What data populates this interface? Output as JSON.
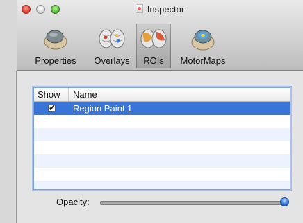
{
  "window": {
    "title": "Inspector"
  },
  "toolbar": {
    "items": [
      {
        "label": "Properties",
        "icon": "head-model-icon"
      },
      {
        "label": "Overlays",
        "icon": "brain-overlay-icon"
      },
      {
        "label": "ROIs",
        "icon": "brain-roi-icon",
        "selected": true
      },
      {
        "label": "MotorMaps",
        "icon": "motor-map-icon"
      }
    ]
  },
  "roi_table": {
    "columns": [
      "Show",
      "Name"
    ],
    "rows": [
      {
        "show": true,
        "name": "Region Paint 1",
        "selected": true
      }
    ]
  },
  "opacity": {
    "label": "Opacity:",
    "value": 1.0
  },
  "colors": {
    "selection": "#3875d7",
    "accent": "#2c6ed1"
  }
}
